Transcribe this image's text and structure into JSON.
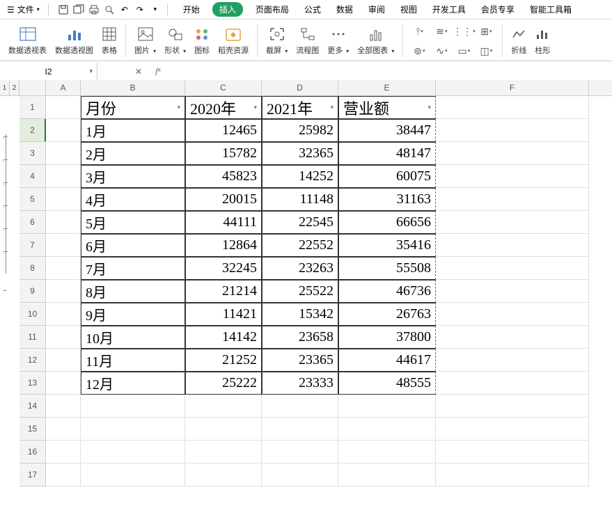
{
  "menu": {
    "file_label": "文件",
    "tabs": [
      "开始",
      "插入",
      "页面布局",
      "公式",
      "数据",
      "审阅",
      "视图",
      "开发工具",
      "会员专享",
      "智能工具箱"
    ],
    "active_tab_index": 1
  },
  "ribbon": {
    "groups": [
      {
        "label": "数据透视表",
        "icon": "pivot-table"
      },
      {
        "label": "数据透视图",
        "icon": "pivot-chart"
      },
      {
        "label": "表格",
        "icon": "table"
      },
      {
        "label": "图片",
        "icon": "picture",
        "dd": true
      },
      {
        "label": "形状",
        "icon": "shapes",
        "dd": true
      },
      {
        "label": "图标",
        "icon": "icons"
      },
      {
        "label": "稻壳资源",
        "icon": "resource"
      },
      {
        "label": "截屏",
        "icon": "screenshot",
        "dd": true
      },
      {
        "label": "流程图",
        "icon": "flowchart"
      },
      {
        "label": "更多",
        "icon": "more",
        "dd": true
      },
      {
        "label": "全部图表",
        "icon": "allcharts",
        "dd": true
      },
      {
        "label": "折线",
        "icon": "sparkline-line"
      },
      {
        "label": "柱形",
        "icon": "sparkline-bar"
      }
    ]
  },
  "formula_bar": {
    "name_box": "I2",
    "formula": ""
  },
  "columns": [
    "A",
    "B",
    "C",
    "D",
    "E",
    "F"
  ],
  "outline_levels": [
    "1",
    "2"
  ],
  "headers": {
    "B": "月份",
    "C": "2020年",
    "D": "2021年",
    "E": "营业额"
  },
  "rows": [
    {
      "n": 1,
      "type": "header"
    },
    {
      "n": 2,
      "B": "1月",
      "C": 12465,
      "D": 25982,
      "E": 38447
    },
    {
      "n": 3,
      "B": "2月",
      "C": 15782,
      "D": 32365,
      "E": 48147
    },
    {
      "n": 4,
      "B": "3月",
      "C": 45823,
      "D": 14252,
      "E": 60075
    },
    {
      "n": 5,
      "B": "4月",
      "C": 20015,
      "D": 11148,
      "E": 31163
    },
    {
      "n": 6,
      "B": "5月",
      "C": 44111,
      "D": 22545,
      "E": 66656
    },
    {
      "n": 7,
      "B": "6月",
      "C": 12864,
      "D": 22552,
      "E": 35416
    },
    {
      "n": 8,
      "B": "7月",
      "C": 32245,
      "D": 23263,
      "E": 55508
    },
    {
      "n": 9,
      "B": "8月",
      "C": 21214,
      "D": 25522,
      "E": 46736
    },
    {
      "n": 10,
      "B": "9月",
      "C": 11421,
      "D": 15342,
      "E": 26763
    },
    {
      "n": 11,
      "B": "10月",
      "C": 14142,
      "D": 23658,
      "E": 37800
    },
    {
      "n": 12,
      "B": "11月",
      "C": 21252,
      "D": 23365,
      "E": 44617
    },
    {
      "n": 13,
      "B": "12月",
      "C": 25222,
      "D": 23333,
      "E": 48555
    },
    {
      "n": 14
    },
    {
      "n": 15
    },
    {
      "n": 16
    },
    {
      "n": 17
    }
  ],
  "active_row": 2,
  "chart_data": {
    "type": "table",
    "title": "营业额",
    "categories": [
      "1月",
      "2月",
      "3月",
      "4月",
      "5月",
      "6月",
      "7月",
      "8月",
      "9月",
      "10月",
      "11月",
      "12月"
    ],
    "series": [
      {
        "name": "2020年",
        "values": [
          12465,
          15782,
          45823,
          20015,
          44111,
          12864,
          32245,
          21214,
          11421,
          14142,
          21252,
          25222
        ]
      },
      {
        "name": "2021年",
        "values": [
          25982,
          32365,
          14252,
          11148,
          22545,
          22552,
          23263,
          25522,
          15342,
          23658,
          23365,
          23333
        ]
      },
      {
        "name": "营业额",
        "values": [
          38447,
          48147,
          60075,
          31163,
          66656,
          35416,
          55508,
          46736,
          26763,
          37800,
          44617,
          48555
        ]
      }
    ]
  }
}
